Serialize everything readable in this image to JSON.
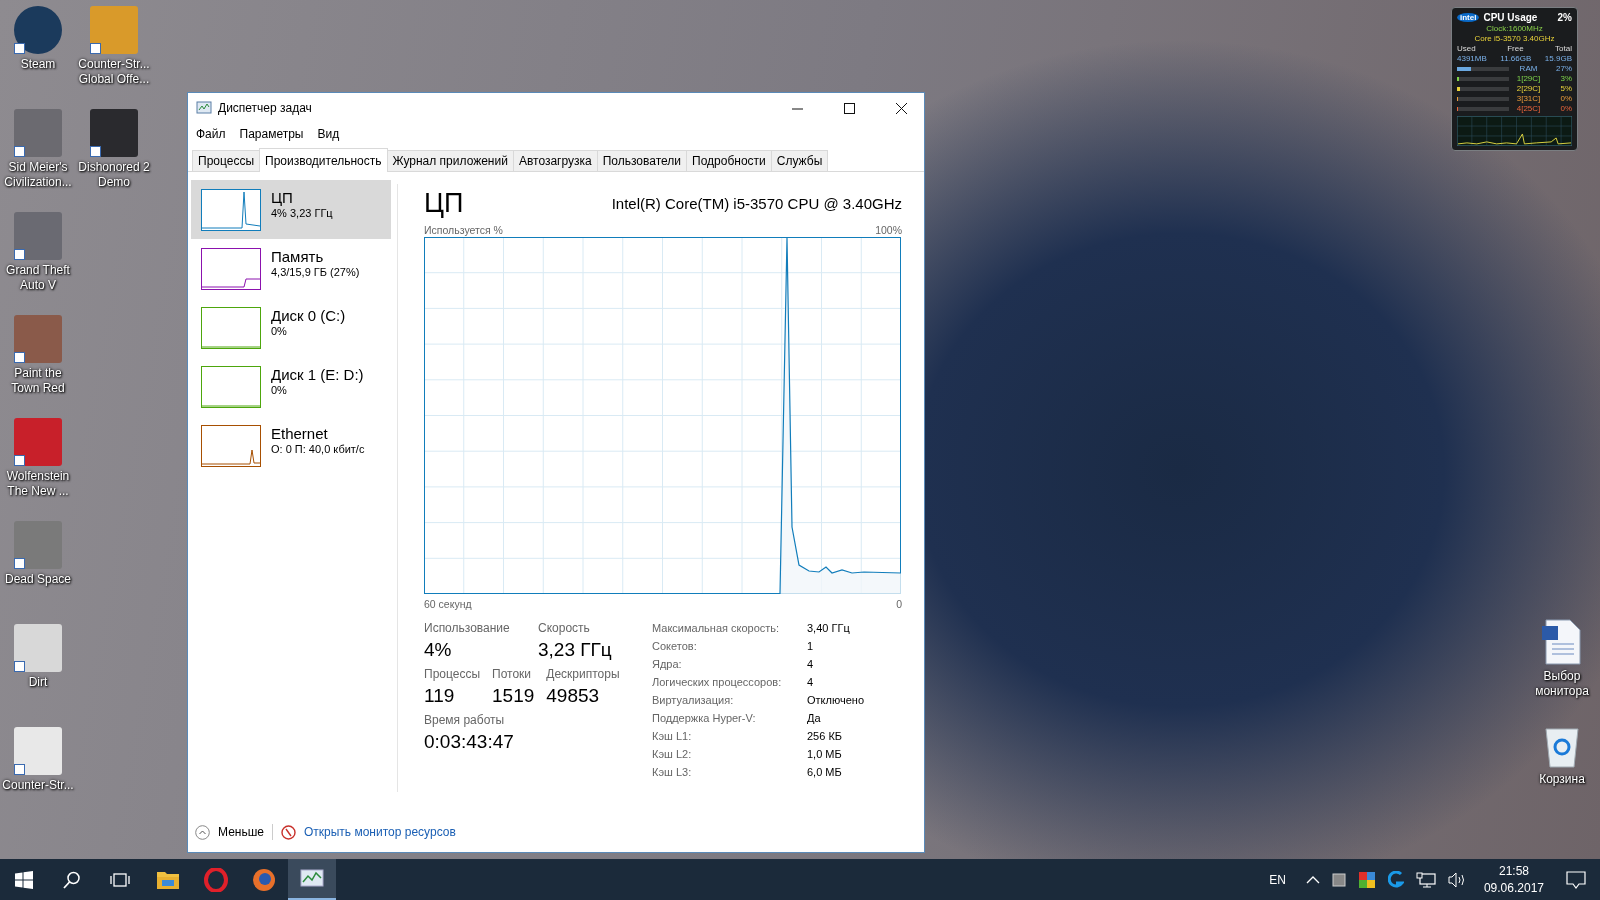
{
  "desktop": {
    "columns": [
      [
        {
          "label": "Steam",
          "kind": "steam"
        },
        {
          "label": "Sid Meier's Civilization...",
          "kind": "civ"
        },
        {
          "label": "Grand Theft Auto V",
          "kind": "gta"
        },
        {
          "label": "Paint the Town Red",
          "kind": "pixel"
        },
        {
          "label": "Wolfenstein The New ...",
          "kind": "wolf"
        },
        {
          "label": "Dead Space",
          "kind": "dead"
        },
        {
          "label": "Dirt",
          "kind": "dirt"
        },
        {
          "label": "Counter-Str...",
          "kind": "cs"
        }
      ],
      [
        {
          "label": "Counter-Str... Global Offe...",
          "kind": "csgo"
        },
        {
          "label": "Dishonored 2 Demo",
          "kind": "dish"
        }
      ]
    ],
    "right_icons": [
      {
        "label": "Выбор монитора",
        "kind": "doc"
      },
      {
        "label": "Корзина",
        "kind": "bin"
      }
    ]
  },
  "gadget": {
    "logo": "intel",
    "title": "CPU Usage",
    "usage": "2%",
    "clock": "Clock:1600MHz",
    "cpu": "Core i5-3570 3.40GHz",
    "headers": [
      "Used",
      "Free",
      "Total"
    ],
    "values": [
      "4391MB",
      "11.66GB",
      "15.9GB"
    ],
    "ram": {
      "label": "RAM",
      "value": "27%",
      "level": 0.27
    },
    "cores": [
      {
        "label": "1[29C]",
        "value": "3%",
        "level": 0.03
      },
      {
        "label": "2[29C]",
        "value": "5%",
        "level": 0.05
      },
      {
        "label": "3[31C]",
        "value": "0%",
        "level": 0
      },
      {
        "label": "4[25C]",
        "value": "0%",
        "level": 0
      }
    ]
  },
  "window": {
    "title": "Диспетчер задач",
    "menu": [
      "Файл",
      "Параметры",
      "Вид"
    ],
    "tabs": [
      {
        "label": "Процессы",
        "selected": false
      },
      {
        "label": "Производительность",
        "selected": true
      },
      {
        "label": "Журнал приложений",
        "selected": false
      },
      {
        "label": "Автозагрузка",
        "selected": false
      },
      {
        "label": "Пользователи",
        "selected": false
      },
      {
        "label": "Подробности",
        "selected": false
      },
      {
        "label": "Службы",
        "selected": false
      }
    ],
    "sidebar": {
      "items": [
        {
          "name": "ЦП",
          "detail": "4% 3,23 ГГц",
          "kind": "cpu",
          "color": "#117dbb",
          "selected": true
        },
        {
          "name": "Память",
          "detail": "4,3/15,9 ГБ (27%)",
          "kind": "memory",
          "color": "#8b12ae",
          "selected": false
        },
        {
          "name": "Диск 0 (C:)",
          "detail": "0%",
          "kind": "disk",
          "color": "#4da60c",
          "selected": false
        },
        {
          "name": "Диск 1 (E: D:)",
          "detail": "0%",
          "kind": "disk",
          "color": "#4da60c",
          "selected": false
        },
        {
          "name": "Ethernet",
          "detail": "О: 0 П: 40,0 кбит/с",
          "kind": "network",
          "color": "#a74f01",
          "selected": false
        }
      ]
    },
    "pane": {
      "heading": "ЦП",
      "model": "Intel(R) Core(TM) i5-3570 CPU @ 3.40GHz",
      "graph_label": "Используется %",
      "graph_max": "100%",
      "graph_span": "60 секунд",
      "graph_min": "0",
      "main_stats": [
        {
          "label": "Использование",
          "value": "4%"
        },
        {
          "label": "Скорость",
          "value": "3,23 ГГц"
        }
      ],
      "counts": [
        {
          "label": "Процессы",
          "value": "119"
        },
        {
          "label": "Потоки",
          "value": "1519"
        },
        {
          "label": "Дескрипторы",
          "value": "49853"
        }
      ],
      "uptime": {
        "label": "Время работы",
        "value": "0:03:43:47"
      },
      "specs": [
        {
          "label": "Максимальная скорость:",
          "value": "3,40 ГГц"
        },
        {
          "label": "Сокетов:",
          "value": "1"
        },
        {
          "label": "Ядра:",
          "value": "4"
        },
        {
          "label": "Логических процессоров:",
          "value": "4"
        },
        {
          "label": "Виртуализация:",
          "value": "Отключено"
        },
        {
          "label": "Поддержка Hyper-V:",
          "value": "Да"
        },
        {
          "label": "Кэш L1:",
          "value": "256 КБ"
        },
        {
          "label": "Кэш L2:",
          "value": "1,0 МБ"
        },
        {
          "label": "Кэш L3:",
          "value": "6,0 МБ"
        }
      ]
    },
    "footer": {
      "less": "Меньше",
      "link": "Открыть монитор ресурсов"
    }
  },
  "taskbar": {
    "apps": [
      {
        "kind": "explorer",
        "selected": false
      },
      {
        "kind": "opera",
        "selected": false
      },
      {
        "kind": "firefox",
        "selected": false
      },
      {
        "kind": "taskmgr",
        "selected": true
      }
    ],
    "language": "EN",
    "time": "21:58",
    "date": "09.06.2017"
  }
}
